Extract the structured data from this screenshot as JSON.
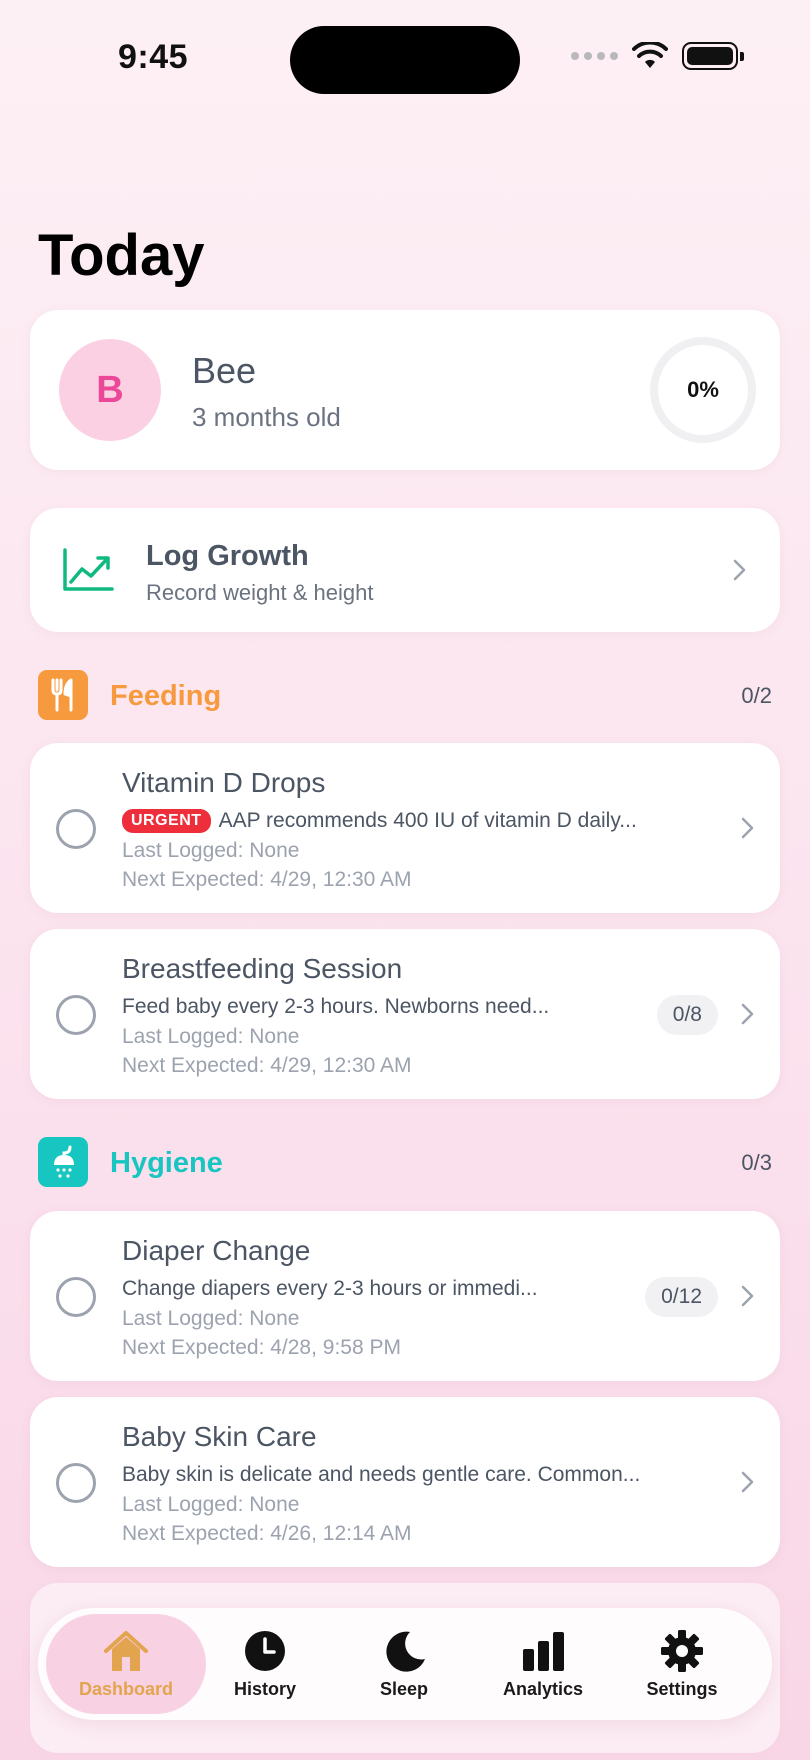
{
  "status_bar": {
    "time": "9:45"
  },
  "page": {
    "title": "Today"
  },
  "profile": {
    "initial": "B",
    "name": "Bee",
    "age": "3 months old",
    "progress_label": "0%"
  },
  "growth": {
    "title": "Log Growth",
    "subtitle": "Record weight & height"
  },
  "sections": [
    {
      "title": "Feeding",
      "count": "0/2",
      "color": "#f79a3e",
      "icon": "fork-knife-icon",
      "tasks": [
        {
          "title": "Vitamin D Drops",
          "badge": "URGENT",
          "description": "AAP recommends 400 IU of vitamin D daily...",
          "last_logged": "Last Logged: None",
          "next_expected": "Next Expected: 4/29, 12:30 AM"
        },
        {
          "title": "Breastfeeding Session",
          "description": "Feed baby every 2-3 hours. Newborns need...",
          "last_logged": "Last Logged: None",
          "next_expected": "Next Expected: 4/29, 12:30 AM",
          "count": "0/8"
        }
      ]
    },
    {
      "title": "Hygiene",
      "count": "0/3",
      "color": "#17c6c0",
      "icon": "shower-icon",
      "tasks": [
        {
          "title": "Diaper Change",
          "description": "Change diapers every 2-3 hours or immedi...",
          "last_logged": "Last Logged: None",
          "next_expected": "Next Expected: 4/28, 9:58 PM",
          "count": "0/12"
        },
        {
          "title": "Baby Skin Care",
          "description": "Baby skin is delicate and needs gentle care. Common...",
          "last_logged": "Last Logged: None",
          "next_expected": "Next Expected: 4/26, 12:14 AM"
        }
      ]
    }
  ],
  "nav": {
    "items": [
      {
        "label": "Dashboard",
        "icon": "house-icon",
        "active": true
      },
      {
        "label": "History",
        "icon": "clock-icon"
      },
      {
        "label": "Sleep",
        "icon": "moon-icon"
      },
      {
        "label": "Analytics",
        "icon": "bar-chart-icon"
      },
      {
        "label": "Settings",
        "icon": "gear-icon"
      }
    ]
  },
  "colors": {
    "accent_pink": "#ec4899",
    "growth_green": "#10b981",
    "urgent_red": "#ef2e3b",
    "nav_active": "#e3a450"
  }
}
